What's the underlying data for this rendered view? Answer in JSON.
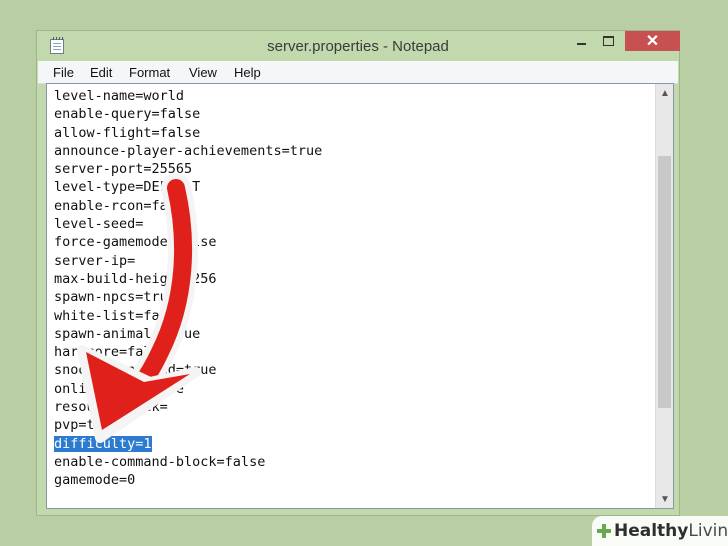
{
  "window": {
    "title": "server.properties - Notepad",
    "app_icon": "notepad-icon",
    "controls": {
      "minimize": "minimize-icon",
      "maximize": "maximize-icon",
      "close": "✕"
    }
  },
  "menu": [
    "File",
    "Edit",
    "Format",
    "View",
    "Help"
  ],
  "editor": {
    "lines": [
      "level-name=world",
      "enable-query=false",
      "allow-flight=false",
      "announce-player-achievements=true",
      "server-port=25565",
      "level-type=DEFAULT",
      "enable-rcon=false",
      "level-seed=",
      "force-gamemode=false",
      "server-ip=",
      "max-build-height=256",
      "spawn-npcs=true",
      "white-list=false",
      "spawn-animals=true",
      "hardcore=false",
      "snooper-enabled=true",
      "online-mode=true",
      "resource-pack=",
      "pvp=true",
      "difficulty=1",
      "enable-command-block=false",
      "gamemode=0"
    ],
    "selected_line_index": 19
  },
  "scrollbar": {
    "up_icon": "▲",
    "down_icon": "▼"
  },
  "overlay": {
    "icon": "red-arrow-icon",
    "color": "#e0201b"
  },
  "watermark": {
    "bold": "Healthy",
    "rest": "Living",
    "icon": "plus-leaf-icon",
    "color": "#6aa84f"
  }
}
